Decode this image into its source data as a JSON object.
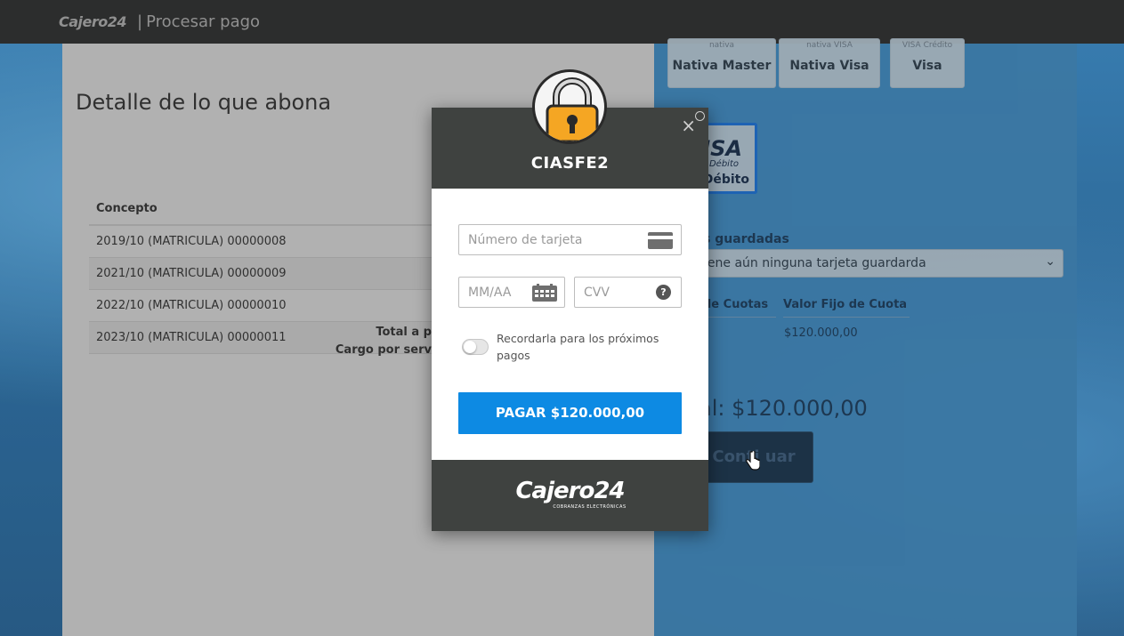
{
  "topbar": {
    "logo": "Cajero24",
    "separator": "|",
    "title": "Procesar pago"
  },
  "detail": {
    "heading": "Detalle de lo que abona",
    "column_header": "Concepto",
    "rows": [
      "2019/10 (MATRICULA) 00000008",
      "2021/10 (MATRICULA) 00000009",
      "2022/10 (MATRICULA) 00000010",
      "2023/10 (MATRICULA) 00000011"
    ],
    "total_label": "Total a p",
    "service_label": "Cargo por serv"
  },
  "payment_methods": [
    {
      "brand": "nativa",
      "label": "Nativa Master"
    },
    {
      "brand": "nativa VISA",
      "label": "Nativa Visa"
    },
    {
      "brand": "VISA Crédito",
      "label": "Visa"
    }
  ],
  "debit_card": {
    "brand": "ISA",
    "sub": "Débito",
    "label": "Débito"
  },
  "saved_cards": {
    "label": "s guardadas",
    "select_value": "iene aún ninguna tarjeta guardarda"
  },
  "cuotas": {
    "col1": "de Cuotas",
    "col2": "Valor Fijo de Cuota",
    "value": "$120.000,00"
  },
  "total_text": "al: $120.000,00",
  "continue_label": "Conti   uar",
  "modal": {
    "store_name": "CIASFE2",
    "close_symbol": "×",
    "card_number_placeholder": "Número de tarjeta",
    "expiry_placeholder": "MM/AA",
    "cvv_placeholder": "CVV",
    "cvv_help": "?",
    "remember_label": "Recordarla para los próximos pagos",
    "pay_button": "PAGAR $120.000,00",
    "footer_logo": "Cajero24",
    "footer_sub": "COBRANZAS ELECTRÓNICAS"
  },
  "colors": {
    "pay_button": "#0d8ae3",
    "modal_header": "#3f4240",
    "lock_body": "#f5a623",
    "debit_border": "#1f6ac1"
  }
}
